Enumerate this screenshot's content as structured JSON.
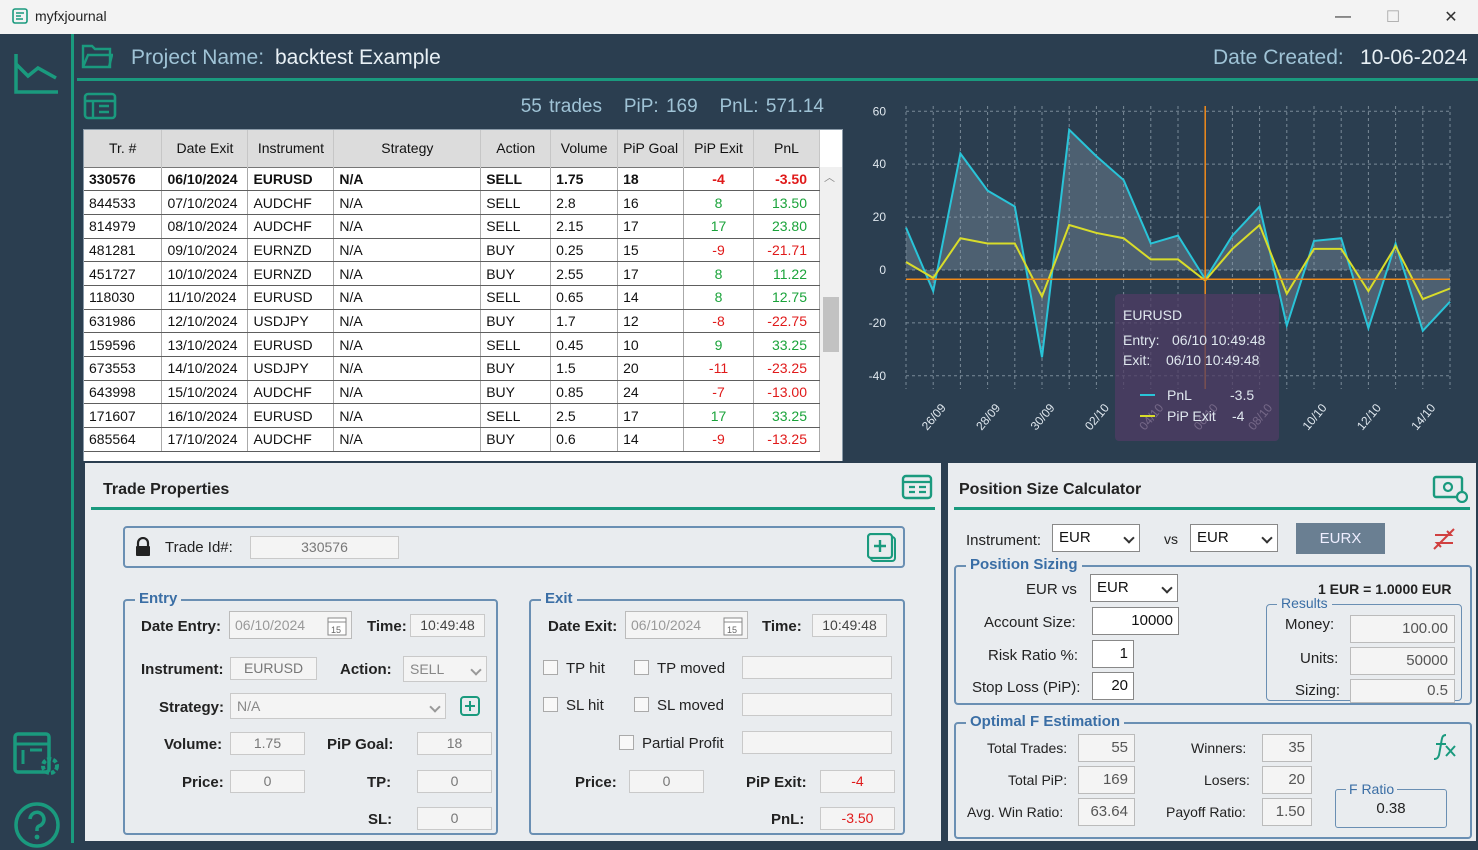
{
  "window": {
    "title": "myfxjournal",
    "minimize": "—",
    "maximize": "☐",
    "close": "✕"
  },
  "header": {
    "project_label": "Project Name:",
    "project_name": "backtest Example",
    "date_label": "Date Created:",
    "date_value": "10-06-2024"
  },
  "summary": {
    "trades": "55 trades",
    "pip_label": "PiP:",
    "pip_value": "169",
    "pnl_label": "PnL:",
    "pnl_value": "571.14"
  },
  "table": {
    "columns": [
      "Tr. #",
      "Date Exit",
      "Instrument",
      "Strategy",
      "Action",
      "Volume",
      "PiP Goal",
      "PiP Exit",
      "PnL"
    ],
    "rows": [
      [
        "330576",
        "06/10/2024",
        "EURUSD",
        "N/A",
        "SELL",
        "1.75",
        "18",
        "-4",
        "-3.50"
      ],
      [
        "844533",
        "07/10/2024",
        "AUDCHF",
        "N/A",
        "SELL",
        "2.8",
        "16",
        "8",
        "13.50"
      ],
      [
        "814979",
        "08/10/2024",
        "AUDCHF",
        "N/A",
        "SELL",
        "2.15",
        "17",
        "17",
        "23.80"
      ],
      [
        "481281",
        "09/10/2024",
        "EURNZD",
        "N/A",
        "BUY",
        "0.25",
        "15",
        "-9",
        "-21.71"
      ],
      [
        "451727",
        "10/10/2024",
        "EURNZD",
        "N/A",
        "BUY",
        "2.55",
        "17",
        "8",
        "11.22"
      ],
      [
        "118030",
        "11/10/2024",
        "EURUSD",
        "N/A",
        "SELL",
        "0.65",
        "14",
        "8",
        "12.75"
      ],
      [
        "631986",
        "12/10/2024",
        "USDJPY",
        "N/A",
        "BUY",
        "1.7",
        "12",
        "-8",
        "-22.75"
      ],
      [
        "159596",
        "13/10/2024",
        "EURUSD",
        "N/A",
        "SELL",
        "0.45",
        "10",
        "9",
        "33.25"
      ],
      [
        "673553",
        "14/10/2024",
        "USDJPY",
        "N/A",
        "BUY",
        "1.5",
        "20",
        "-11",
        "-23.25"
      ],
      [
        "643998",
        "15/10/2024",
        "AUDCHF",
        "N/A",
        "BUY",
        "0.85",
        "24",
        "-7",
        "-13.00"
      ],
      [
        "171607",
        "16/10/2024",
        "EURUSD",
        "N/A",
        "SELL",
        "2.5",
        "17",
        "17",
        "33.25"
      ],
      [
        "685564",
        "17/10/2024",
        "AUDCHF",
        "N/A",
        "BUY",
        "0.6",
        "14",
        "-9",
        "-13.25"
      ]
    ]
  },
  "chart_data": {
    "type": "line",
    "x": [
      "25/09",
      "26/09",
      "27/09",
      "28/09",
      "29/09",
      "30/09",
      "01/10",
      "02/10",
      "03/10",
      "04/10",
      "05/10",
      "06/10",
      "07/10",
      "08/10",
      "09/10",
      "10/10",
      "11/10",
      "12/10",
      "13/10",
      "14/10",
      "15/10"
    ],
    "x_tick_labels": [
      "26/09",
      "28/09",
      "30/09",
      "02/10",
      "04/10",
      "06/10",
      "08/10",
      "10/10",
      "12/10",
      "14/10"
    ],
    "ylim": [
      -45,
      62
    ],
    "y_ticks": [
      60,
      40,
      20,
      0,
      -20,
      -40
    ],
    "grid": true,
    "series": [
      {
        "name": "PnL",
        "color": "#29c4d8",
        "values": [
          16,
          -8,
          44,
          30,
          24,
          -33,
          53,
          43,
          34,
          10,
          13,
          -3.5,
          13,
          24,
          -21,
          11,
          12,
          -22,
          10,
          -23,
          -12
        ]
      },
      {
        "name": "PiP Exit",
        "color": "#d8dc2a",
        "values": [
          3,
          -3,
          12,
          10,
          10,
          -10,
          17,
          14,
          12,
          4,
          4,
          -4,
          8,
          17,
          -9,
          8,
          8,
          -8,
          9,
          -11,
          -7
        ]
      }
    ],
    "tooltip": {
      "instrument": "EURUSD",
      "entry_label": "Entry:",
      "entry": "06/10 10:49:48",
      "exit_label": "Exit:",
      "exit": "06/10 10:49:48",
      "pnl_label": "PnL",
      "pnl": "-3.5",
      "pip_label": "PiP Exit",
      "pip": "-4"
    }
  },
  "trade_properties": {
    "title": "Trade Properties",
    "trade_id_label": "Trade Id#:",
    "trade_id": "330576",
    "entry": {
      "title": "Entry",
      "date_label": "Date Entry:",
      "date": "06/10/2024",
      "time_label": "Time:",
      "time": "10:49:48",
      "instrument_label": "Instrument:",
      "instrument": "EURUSD",
      "action_label": "Action:",
      "action": "SELL",
      "strategy_label": "Strategy:",
      "strategy": "N/A",
      "volume_label": "Volume:",
      "volume": "1.75",
      "pip_goal_label": "PiP Goal:",
      "pip_goal": "18",
      "price_label": "Price:",
      "price": "0",
      "tp_label": "TP:",
      "tp": "0",
      "sl_label": "SL:",
      "sl": "0"
    },
    "exit": {
      "title": "Exit",
      "date_label": "Date Exit:",
      "date": "06/10/2024",
      "time_label": "Time:",
      "time": "10:49:48",
      "tp_hit": "TP hit",
      "tp_moved": "TP moved",
      "sl_hit": "SL hit",
      "sl_moved": "SL moved",
      "partial": "Partial Profit",
      "price_label": "Price:",
      "price": "0",
      "pip_exit_label": "PiP Exit:",
      "pip_exit": "-4",
      "pnl_label": "PnL:",
      "pnl": "-3.50"
    }
  },
  "psc": {
    "title": "Position Size Calculator",
    "instrument_label": "Instrument:",
    "instrument1": "EUR",
    "vs_label": "vs",
    "instrument2": "EUR",
    "eurx": "EURX",
    "sizing_title": "Position Sizing",
    "eur_vs": "EUR  vs",
    "eur_vs_value": "EUR",
    "rate": "1 EUR = 1.0000 EUR",
    "account_label": "Account Size:",
    "account": "10000",
    "risk_label": "Risk Ratio %:",
    "risk": "1",
    "stop_label": "Stop Loss (PiP):",
    "stop": "20",
    "results_title": "Results",
    "money_label": "Money:",
    "money": "100.00",
    "units_label": "Units:",
    "units": "50000",
    "sizing_label": "Sizing:",
    "sizing": "0.5",
    "optimal_title": "Optimal F Estimation",
    "total_trades_label": "Total Trades:",
    "total_trades": "55",
    "total_pip_label": "Total PiP:",
    "total_pip": "169",
    "avg_win_label": "Avg. Win Ratio:",
    "avg_win": "63.64",
    "winners_label": "Winners:",
    "winners": "35",
    "losers_label": "Losers:",
    "losers": "20",
    "payoff_label": "Payoff Ratio:",
    "payoff": "1.50",
    "fratio_title": "F Ratio",
    "fratio": "0.38"
  },
  "colors": {
    "accent": "#1a9a7e",
    "background": "#2b3e50",
    "positive": "#1aa33a",
    "negative": "#e01a1a"
  }
}
